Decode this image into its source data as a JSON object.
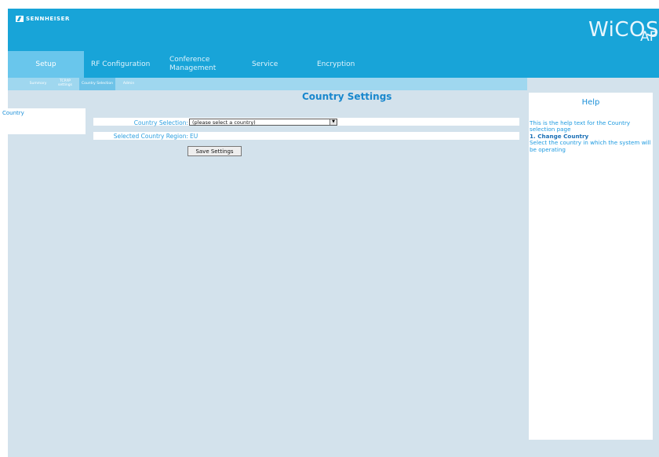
{
  "brand": {
    "logo_text": "SENNHEISER",
    "product_name": "WiCOS",
    "product_sub": "AP"
  },
  "nav": {
    "tabs": [
      {
        "label": "Setup",
        "active": true
      },
      {
        "label": "RF Configuration",
        "active": false
      },
      {
        "label": "Conference Management",
        "active": false
      },
      {
        "label": "Service",
        "active": false
      },
      {
        "label": "Encryption",
        "active": false
      }
    ],
    "subtabs": [
      {
        "label": "Summary",
        "active": false
      },
      {
        "label": "TCP/IP settings",
        "active": false
      },
      {
        "label": "Country Selection",
        "active": true
      },
      {
        "label": "Admin",
        "active": false
      }
    ]
  },
  "main": {
    "title": "Country Settings",
    "sidebar_item": "Country",
    "country_selection_label": "Country Selection:",
    "country_selection_value": "(please select a country)",
    "region_label": "Selected Country Region:",
    "region_value": "EU",
    "save_label": "Save Settings"
  },
  "help": {
    "title": "Help",
    "intro": "This is the help text for the Country selection page",
    "heading": "1. Change Country",
    "text": "Select the country in which the system will be operating"
  },
  "colors": {
    "header": "#18a4d8",
    "active_tab": "#69c6ec",
    "content_bg": "#d3e2ec",
    "accent_text": "#2b9fe0"
  }
}
